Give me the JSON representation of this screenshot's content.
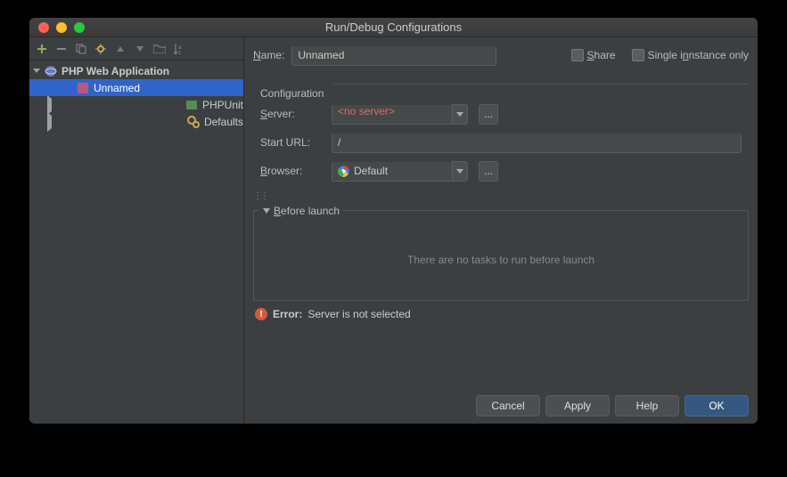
{
  "title": "Run/Debug Configurations",
  "tree": {
    "phpWebApp": "PHP Web Application",
    "unnamed": "Unnamed",
    "phpunit": "PHPUnit",
    "defaults": "Defaults"
  },
  "form": {
    "nameLabel": "ame:",
    "nameValue": "Unnamed",
    "shareLabel": "hare",
    "singleInstanceLabel": "nstance only",
    "singleInstancePrefix": "Single i",
    "configTitle": "Configuration",
    "serverLabel": "erver:",
    "serverValue": "<no server>",
    "startUrlLabel": "Start URL:",
    "startUrlValue": "/",
    "browserLabel": "rowser:",
    "browserValue": "Default",
    "beforeLaunchTitle": "efore launch",
    "beforeLaunchEmpty": "There are no tasks to run before launch",
    "errorLabel": "Error:",
    "errorMsg": "Server is not selected"
  },
  "buttons": {
    "cancel": "Cancel",
    "apply": "Apply",
    "help": "Help",
    "ok": "OK"
  }
}
